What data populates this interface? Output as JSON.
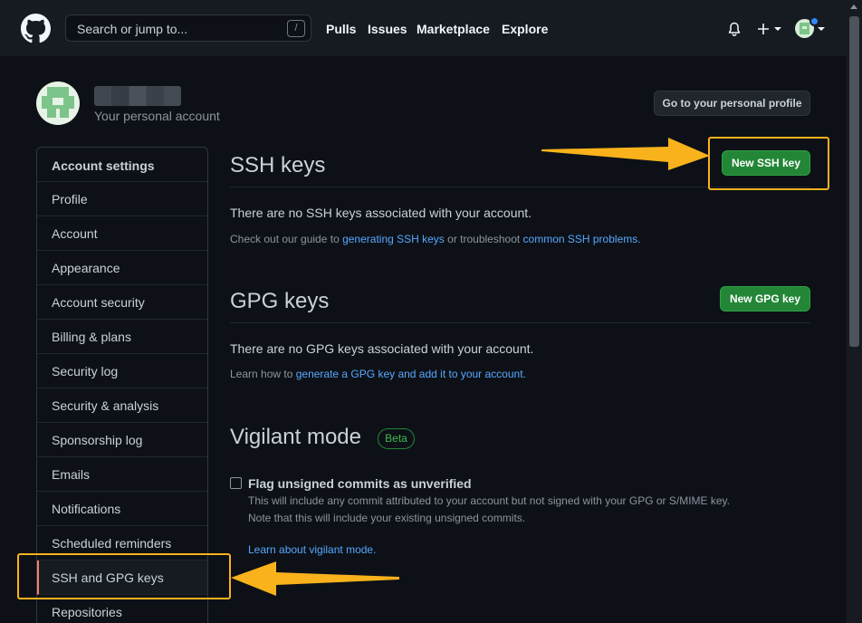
{
  "header": {
    "search_placeholder": "Search or jump to...",
    "search_shortcut": "/",
    "nav": [
      "Pulls",
      "Issues",
      "Marketplace",
      "Explore"
    ]
  },
  "profile": {
    "subtitle": "Your personal account",
    "go_profile_button": "Go to your personal profile"
  },
  "sidebar": {
    "heading": "Account settings",
    "items": [
      "Profile",
      "Account",
      "Appearance",
      "Account security",
      "Billing & plans",
      "Security log",
      "Security & analysis",
      "Sponsorship log",
      "Emails",
      "Notifications",
      "Scheduled reminders",
      "SSH and GPG keys",
      "Repositories"
    ],
    "active_item": "SSH and GPG keys"
  },
  "ssh": {
    "title": "SSH keys",
    "new_button": "New SSH key",
    "empty_text": "There are no SSH keys associated with your account.",
    "help_prefix": "Check out our guide to ",
    "help_link1": "generating SSH keys",
    "help_middle": " or troubleshoot ",
    "help_link2": "common SSH problems",
    "help_suffix": "."
  },
  "gpg": {
    "title": "GPG keys",
    "new_button": "New GPG key",
    "empty_text": "There are no GPG keys associated with your account.",
    "help_prefix": "Learn how to ",
    "help_link": "generate a GPG key and add it to your account",
    "help_suffix": "."
  },
  "vigilant": {
    "title": "Vigilant mode",
    "badge": "Beta",
    "checkbox_label": "Flag unsigned commits as unverified",
    "checked": false,
    "desc1": "This will include any commit attributed to your account but not signed with your GPG or S/MIME key.",
    "desc2": "Note that this will include your existing unsigned commits.",
    "learn_link": "Learn about vigilant mode."
  },
  "colors": {
    "background": "#0d1117",
    "header": "#161b22",
    "primary_button": "#238636",
    "link": "#58a6ff",
    "highlight": "#f9b21c"
  }
}
